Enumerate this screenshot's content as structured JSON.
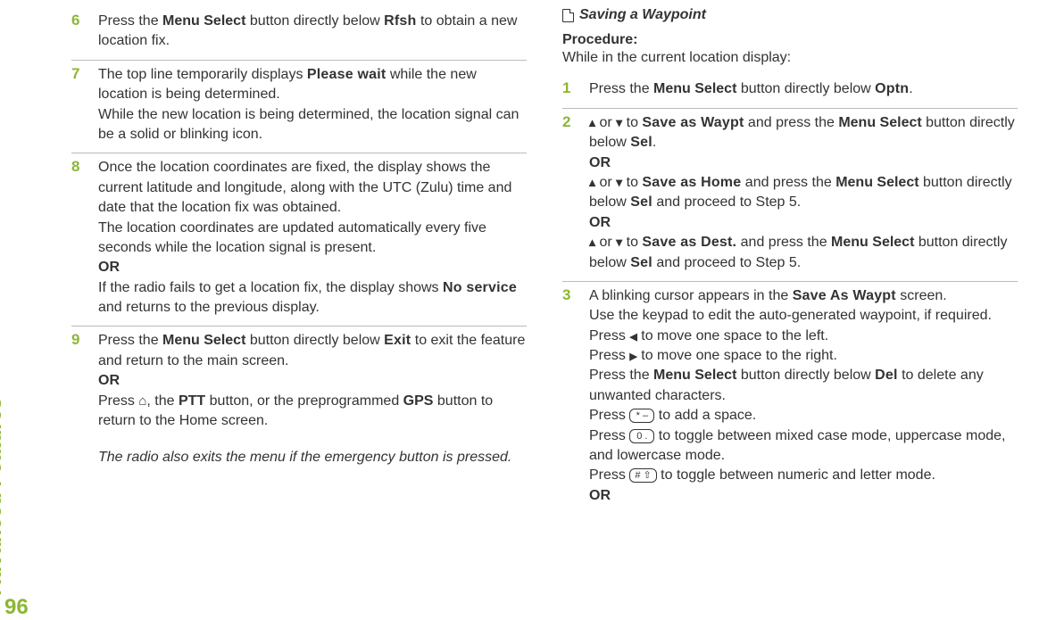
{
  "sidebar": {
    "label": "Advanced Features",
    "page": "96"
  },
  "left": {
    "steps": [
      {
        "n": "6",
        "parts": [
          {
            "t": "Press the "
          },
          {
            "t": "Menu Select",
            "cls": "b"
          },
          {
            "t": " button directly below "
          },
          {
            "t": "Rfsh",
            "cls": "disp"
          },
          {
            "t": " to obtain a new location fix."
          }
        ]
      },
      {
        "n": "7",
        "parts": [
          {
            "t": "The top line temporarily displays "
          },
          {
            "t": "Please wait",
            "cls": "disp"
          },
          {
            "t": " while the new location is being determined."
          },
          {
            "br": true
          },
          {
            "t": "While the new location is being determined, the location signal can be a solid or blinking icon."
          }
        ]
      },
      {
        "n": "8",
        "parts": [
          {
            "t": "Once the location coordinates are fixed, the display shows the current latitude and longitude, along with the UTC (Zulu) time and date that the location fix was obtained."
          },
          {
            "br": true
          },
          {
            "t": "The location coordinates are updated automatically every five seconds while the location signal is present."
          },
          {
            "br": true
          },
          {
            "t": "OR",
            "cls": "or"
          },
          {
            "br": true
          },
          {
            "t": "If the radio fails to get a location fix, the display shows "
          },
          {
            "t": "No service",
            "cls": "disp"
          },
          {
            "t": " and returns to the previous display."
          }
        ]
      },
      {
        "n": "9",
        "parts": [
          {
            "t": "Press the "
          },
          {
            "t": "Menu Select",
            "cls": "b"
          },
          {
            "t": " button directly below "
          },
          {
            "t": "Exit",
            "cls": "disp"
          },
          {
            "t": " to exit the feature and return to the main screen."
          },
          {
            "br": true
          },
          {
            "t": "OR",
            "cls": "or"
          },
          {
            "br": true
          },
          {
            "t": "Press "
          },
          {
            "icon": "home"
          },
          {
            "t": ", the "
          },
          {
            "t": "PTT",
            "cls": "b"
          },
          {
            "t": " button, or the preprogrammed "
          },
          {
            "t": "GPS",
            "cls": "b"
          },
          {
            "t": " button to return to the Home screen."
          }
        ]
      }
    ],
    "note": "The radio also exits the menu if the emergency button is pressed."
  },
  "right": {
    "title": "Saving a Waypoint",
    "proc_label": "Procedure:",
    "proc_desc": "While in the current location display:",
    "steps": [
      {
        "n": "1",
        "parts": [
          {
            "t": "Press the "
          },
          {
            "t": "Menu Select",
            "cls": "b"
          },
          {
            "t": " button directly below "
          },
          {
            "t": "Optn",
            "cls": "disp"
          },
          {
            "t": "."
          }
        ]
      },
      {
        "n": "2",
        "parts": [
          {
            "icon": "up"
          },
          {
            "t": " or "
          },
          {
            "icon": "down"
          },
          {
            "t": " to "
          },
          {
            "t": "Save as Waypt",
            "cls": "disp"
          },
          {
            "t": " and press the "
          },
          {
            "t": "Menu Select",
            "cls": "b"
          },
          {
            "t": " button directly below "
          },
          {
            "t": "Sel",
            "cls": "disp"
          },
          {
            "t": "."
          },
          {
            "br": true
          },
          {
            "t": "OR",
            "cls": "or"
          },
          {
            "br": true
          },
          {
            "icon": "up"
          },
          {
            "t": " or "
          },
          {
            "icon": "down"
          },
          {
            "t": " to "
          },
          {
            "t": "Save as Home",
            "cls": "disp"
          },
          {
            "t": " and press the "
          },
          {
            "t": "Menu Select",
            "cls": "b"
          },
          {
            "t": " button directly below "
          },
          {
            "t": "Sel",
            "cls": "disp"
          },
          {
            "t": " and proceed to Step 5."
          },
          {
            "br": true
          },
          {
            "t": "OR",
            "cls": "or"
          },
          {
            "br": true
          },
          {
            "icon": "up"
          },
          {
            "t": " or "
          },
          {
            "icon": "down"
          },
          {
            "t": " to "
          },
          {
            "t": "Save as Dest.",
            "cls": "disp"
          },
          {
            "t": " and press the "
          },
          {
            "t": "Menu Select",
            "cls": "b"
          },
          {
            "t": " button directly below "
          },
          {
            "t": "Sel",
            "cls": "disp"
          },
          {
            "t": " and proceed to Step 5."
          }
        ]
      },
      {
        "n": "3",
        "parts": [
          {
            "t": "A blinking cursor appears in the "
          },
          {
            "t": "Save As Waypt",
            "cls": "disp"
          },
          {
            "t": " screen."
          },
          {
            "br": true
          },
          {
            "t": "Use the keypad to edit the auto-generated waypoint, if required."
          },
          {
            "br": true
          },
          {
            "t": "Press "
          },
          {
            "icon": "left"
          },
          {
            "t": " to move one space to the left."
          },
          {
            "br": true
          },
          {
            "t": "Press "
          },
          {
            "icon": "right"
          },
          {
            "t": " to move one space to the right."
          },
          {
            "br": true
          },
          {
            "t": "Press the "
          },
          {
            "t": "Menu Select",
            "cls": "b"
          },
          {
            "t": " button directly below "
          },
          {
            "t": "Del",
            "cls": "disp"
          },
          {
            "t": " to delete any unwanted characters."
          },
          {
            "br": true
          },
          {
            "t": "Press "
          },
          {
            "key": "* –"
          },
          {
            "t": " to add a space."
          },
          {
            "br": true
          },
          {
            "t": "Press "
          },
          {
            "key": "0 ."
          },
          {
            "t": " to toggle between mixed case mode, uppercase mode, and lowercase mode."
          },
          {
            "br": true
          },
          {
            "t": "Press "
          },
          {
            "key": "# ⇧"
          },
          {
            "t": " to toggle between numeric and letter mode."
          },
          {
            "br": true
          },
          {
            "t": "OR",
            "cls": "or"
          }
        ]
      }
    ]
  }
}
